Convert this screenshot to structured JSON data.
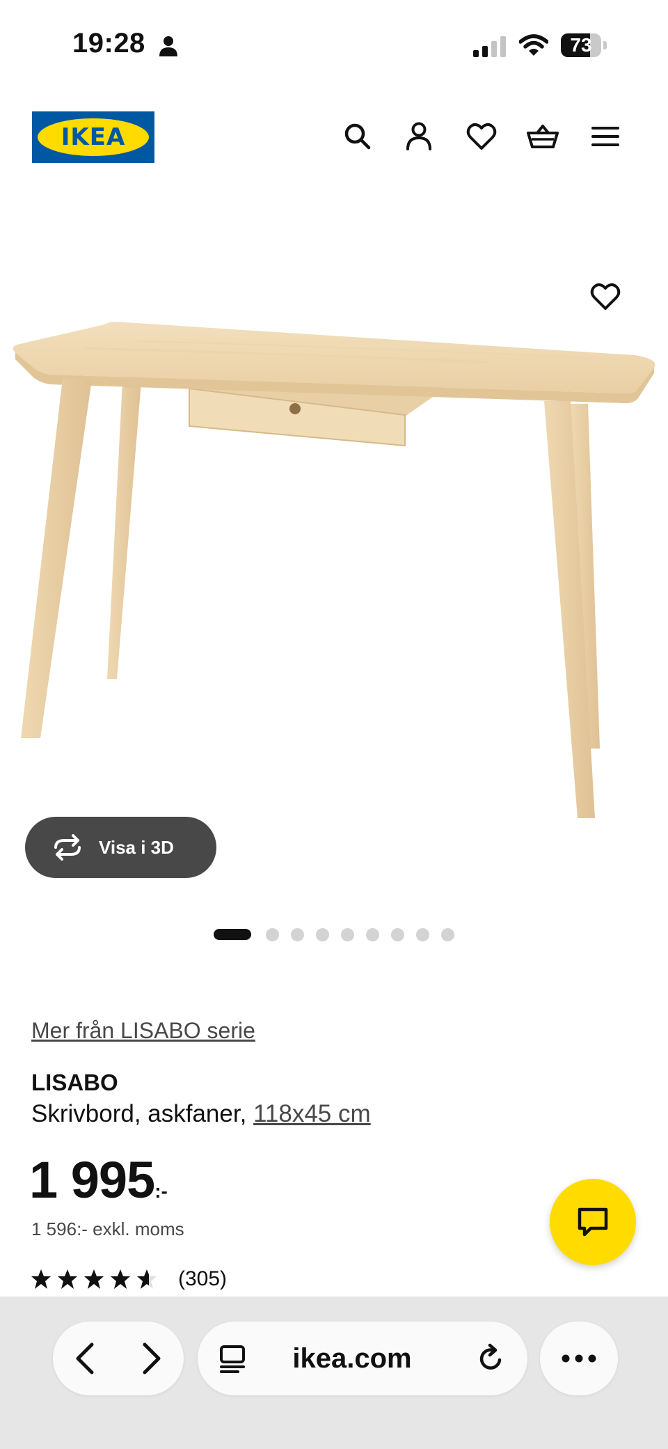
{
  "status_bar": {
    "time": "19:28",
    "battery_percent": "73",
    "battery_level": 0.73
  },
  "header": {
    "logo_text": "IKEA",
    "icons": [
      "search-icon",
      "account-icon",
      "favorites-heart-icon",
      "shopping-basket-icon",
      "hamburger-menu-icon"
    ]
  },
  "gallery": {
    "view_3d_label": "Visa i 3D",
    "image_count": 9,
    "active_index": 0
  },
  "product": {
    "series_link": "Mer från LISABO serie",
    "name": "LISABO",
    "description": "Skrivbord, askfaner,",
    "size_link": "118x45 cm",
    "price": "1 995",
    "price_suffix": ":-",
    "price_excl_vat": "1 596:- exkl. moms",
    "rating": 4.6,
    "review_count": "(305)"
  },
  "browser": {
    "url": "ikea.com"
  },
  "colors": {
    "ikea_blue": "#0058a3",
    "ikea_yellow": "#ffdb00",
    "wood": "#ecd2a8"
  }
}
